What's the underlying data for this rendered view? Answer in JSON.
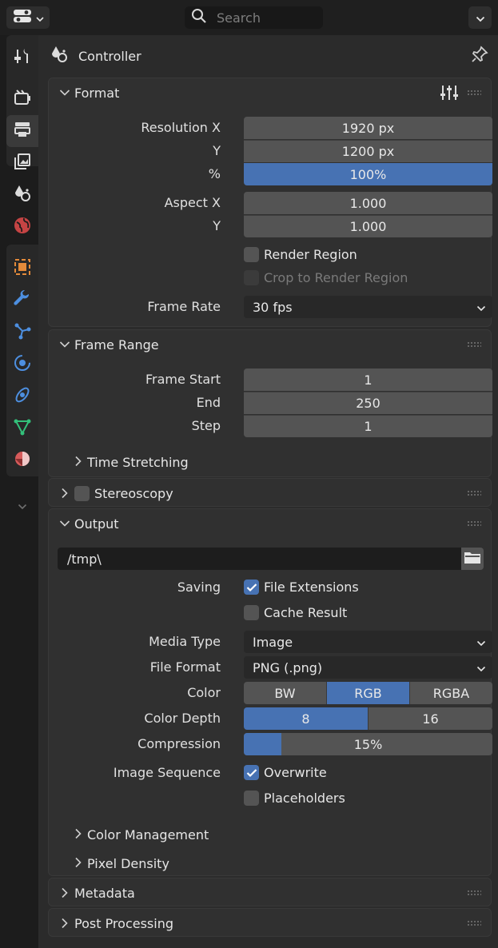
{
  "header": {
    "search_placeholder": "Search"
  },
  "context": {
    "title": "Controller"
  },
  "format": {
    "title": "Format",
    "resolution_x_label": "Resolution X",
    "resolution_x": "1920 px",
    "resolution_y_label": "Y",
    "resolution_y": "1200 px",
    "resolution_pct_label": "%",
    "resolution_pct": "100%",
    "aspect_x_label": "Aspect X",
    "aspect_x": "1.000",
    "aspect_y_label": "Y",
    "aspect_y": "1.000",
    "render_region": "Render Region",
    "crop_region": "Crop to Render Region",
    "frame_rate_label": "Frame Rate",
    "frame_rate": "30 fps"
  },
  "frame_range": {
    "title": "Frame Range",
    "start_label": "Frame Start",
    "start": "1",
    "end_label": "End",
    "end": "250",
    "step_label": "Step",
    "step": "1",
    "time_stretching": "Time Stretching"
  },
  "stereoscopy": {
    "title": "Stereoscopy"
  },
  "output": {
    "title": "Output",
    "path": "/tmp\\",
    "saving_label": "Saving",
    "file_extensions": "File Extensions",
    "cache_result": "Cache Result",
    "media_type_label": "Media Type",
    "media_type": "Image",
    "file_format_label": "File Format",
    "file_format": "PNG (.png)",
    "color_label": "Color",
    "color_options": [
      "BW",
      "RGB",
      "RGBA"
    ],
    "color_selected": "RGB",
    "color_depth_label": "Color Depth",
    "color_depth_options": [
      "8",
      "16"
    ],
    "color_depth_selected": "8",
    "compression_label": "Compression",
    "compression": "15%",
    "compression_fraction": 0.15,
    "image_sequence_label": "Image Sequence",
    "overwrite": "Overwrite",
    "placeholders": "Placeholders",
    "color_management": "Color Management",
    "pixel_density": "Pixel Density"
  },
  "metadata": {
    "title": "Metadata"
  },
  "post_processing": {
    "title": "Post Processing"
  },
  "colors": {
    "accent": "#4772b3",
    "field": "#545454",
    "panel": "#303030"
  }
}
